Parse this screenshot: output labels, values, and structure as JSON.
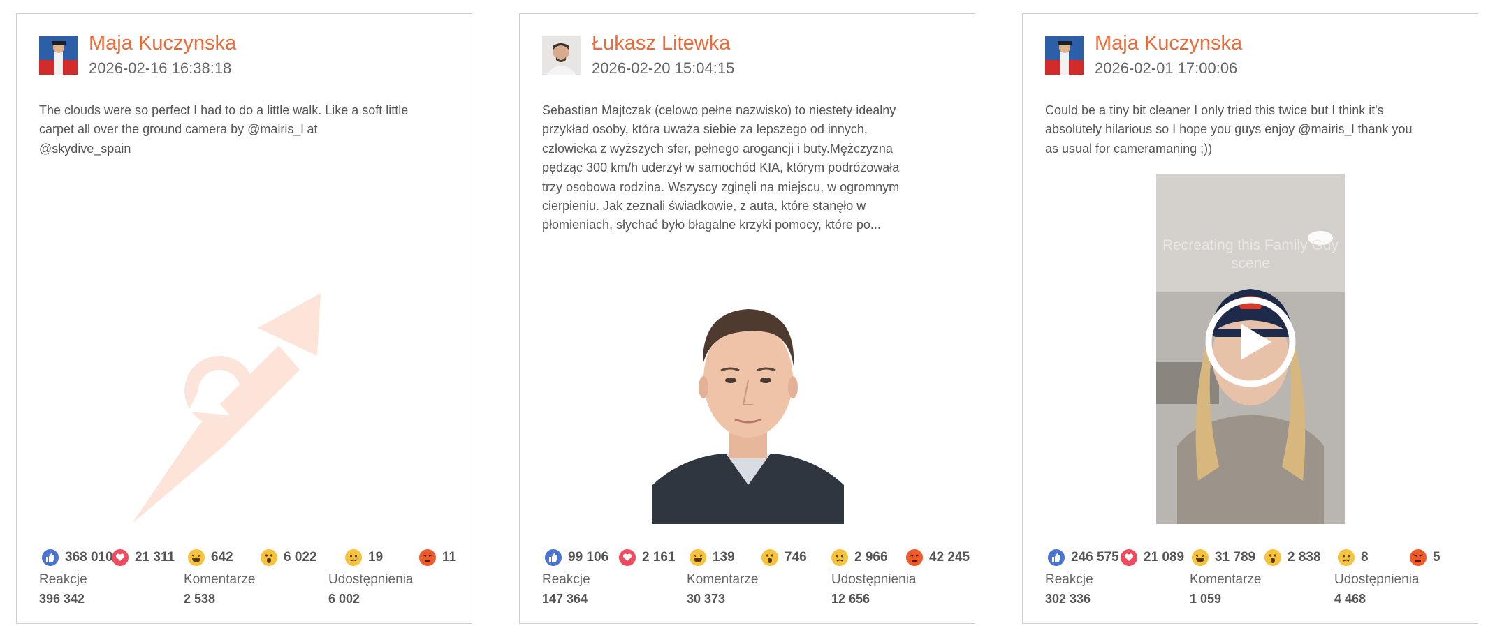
{
  "posts": [
    {
      "author": "Maja Kuczynska",
      "date": "2026-02-16 16:38:18",
      "text": "The clouds were so perfect I had to do a little walk. Like a soft little carpet all over the ground camera by @mairis_l at @skydive_spain",
      "media_type": "placeholder-logo",
      "reactions": {
        "like": "368 010",
        "love": "21 311",
        "haha": "642",
        "wow": "6 022",
        "sad": "19",
        "angry": "11"
      },
      "stats": {
        "reactions_label": "Reakcje",
        "reactions_value": "396 342",
        "comments_label": "Komentarze",
        "comments_value": "2 538",
        "shares_label": "Udostępnienia",
        "shares_value": "6 002"
      }
    },
    {
      "author": "Łukasz Litewka",
      "date": "2026-02-20 15:04:15",
      "text": "Sebastian Majtczak (celowo pełne nazwisko) to niestety idealny przykład osoby, która uważa siebie za lepszego od innych, człowieka z wyższych sfer, pełnego arogancji i buty.Mężczyzna pędząc 300 km/h uderzył w samochód KIA, którym podróżowała trzy osobowa rodzina. Wszyscy zginęli na miejscu, w ogromnym cierpieniu. Jak zeznali świadkowie, z auta, które stanęło w płomieniach, słychać było błagalne krzyki pomocy, które po...",
      "media_type": "portrait-photo",
      "reactions": {
        "like": "99 106",
        "love": "2 161",
        "haha": "139",
        "wow": "746",
        "sad": "2 966",
        "angry": "42 245"
      },
      "stats": {
        "reactions_label": "Reakcje",
        "reactions_value": "147 364",
        "comments_label": "Komentarze",
        "comments_value": "30 373",
        "shares_label": "Udostępnienia",
        "shares_value": "12 656"
      }
    },
    {
      "author": "Maja Kuczynska",
      "date": "2026-02-01 17:00:06",
      "text": "Could be a tiny bit cleaner I only tried this twice but I think it's absolutely hilarious so I hope you guys enjoy @mairis_l thank you as usual for cameramaning ;))",
      "media_type": "video-thumbnail",
      "media_overlay_text": "Recreating this Family Guy scene",
      "reactions": {
        "like": "246 575",
        "love": "21 089",
        "haha": "31 789",
        "wow": "2 838",
        "sad": "8",
        "angry": "5"
      },
      "stats": {
        "reactions_label": "Reakcje",
        "reactions_value": "302 336",
        "comments_label": "Komentarze",
        "comments_value": "1 059",
        "shares_label": "Udostępnienia",
        "shares_value": "4 468"
      }
    }
  ],
  "colors": {
    "accent": "#ef6a36",
    "like": "#4a74d1",
    "love": "#ef4b5e",
    "emoji": "#f7c23c",
    "angry": "#ee5a2a",
    "border": "#cfcfcf"
  }
}
